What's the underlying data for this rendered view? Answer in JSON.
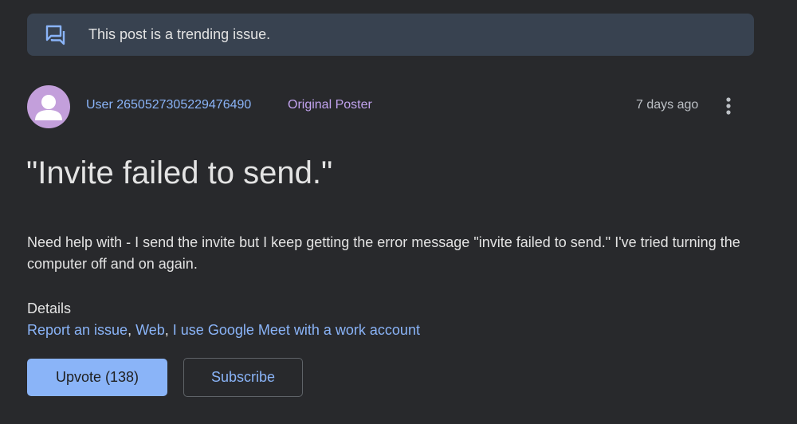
{
  "banner": {
    "icon": "forum-icon",
    "text": "This post is a trending issue."
  },
  "post": {
    "author": "User 2650527305229476490",
    "author_badge": "Original Poster",
    "timestamp": "7 days ago",
    "avatar_icon": "person-icon",
    "more_icon": "more-vert-icon",
    "title": "\"Invite failed to send.\"",
    "body": "Need help with - I send the invite but I keep getting the error message \"invite failed to send.\" I've tried turning the computer off and on again.",
    "details_heading": "Details",
    "details_links": [
      "Report an issue",
      "Web",
      "I use Google Meet with a work account"
    ],
    "details_separator": ", "
  },
  "actions": {
    "upvote_label": "Upvote (138)",
    "subscribe_label": "Subscribe"
  },
  "colors": {
    "background": "#28292c",
    "banner": "#384250",
    "link": "#8ab4f8",
    "badge": "#c2a3ef",
    "avatar": "#c39fdb"
  }
}
